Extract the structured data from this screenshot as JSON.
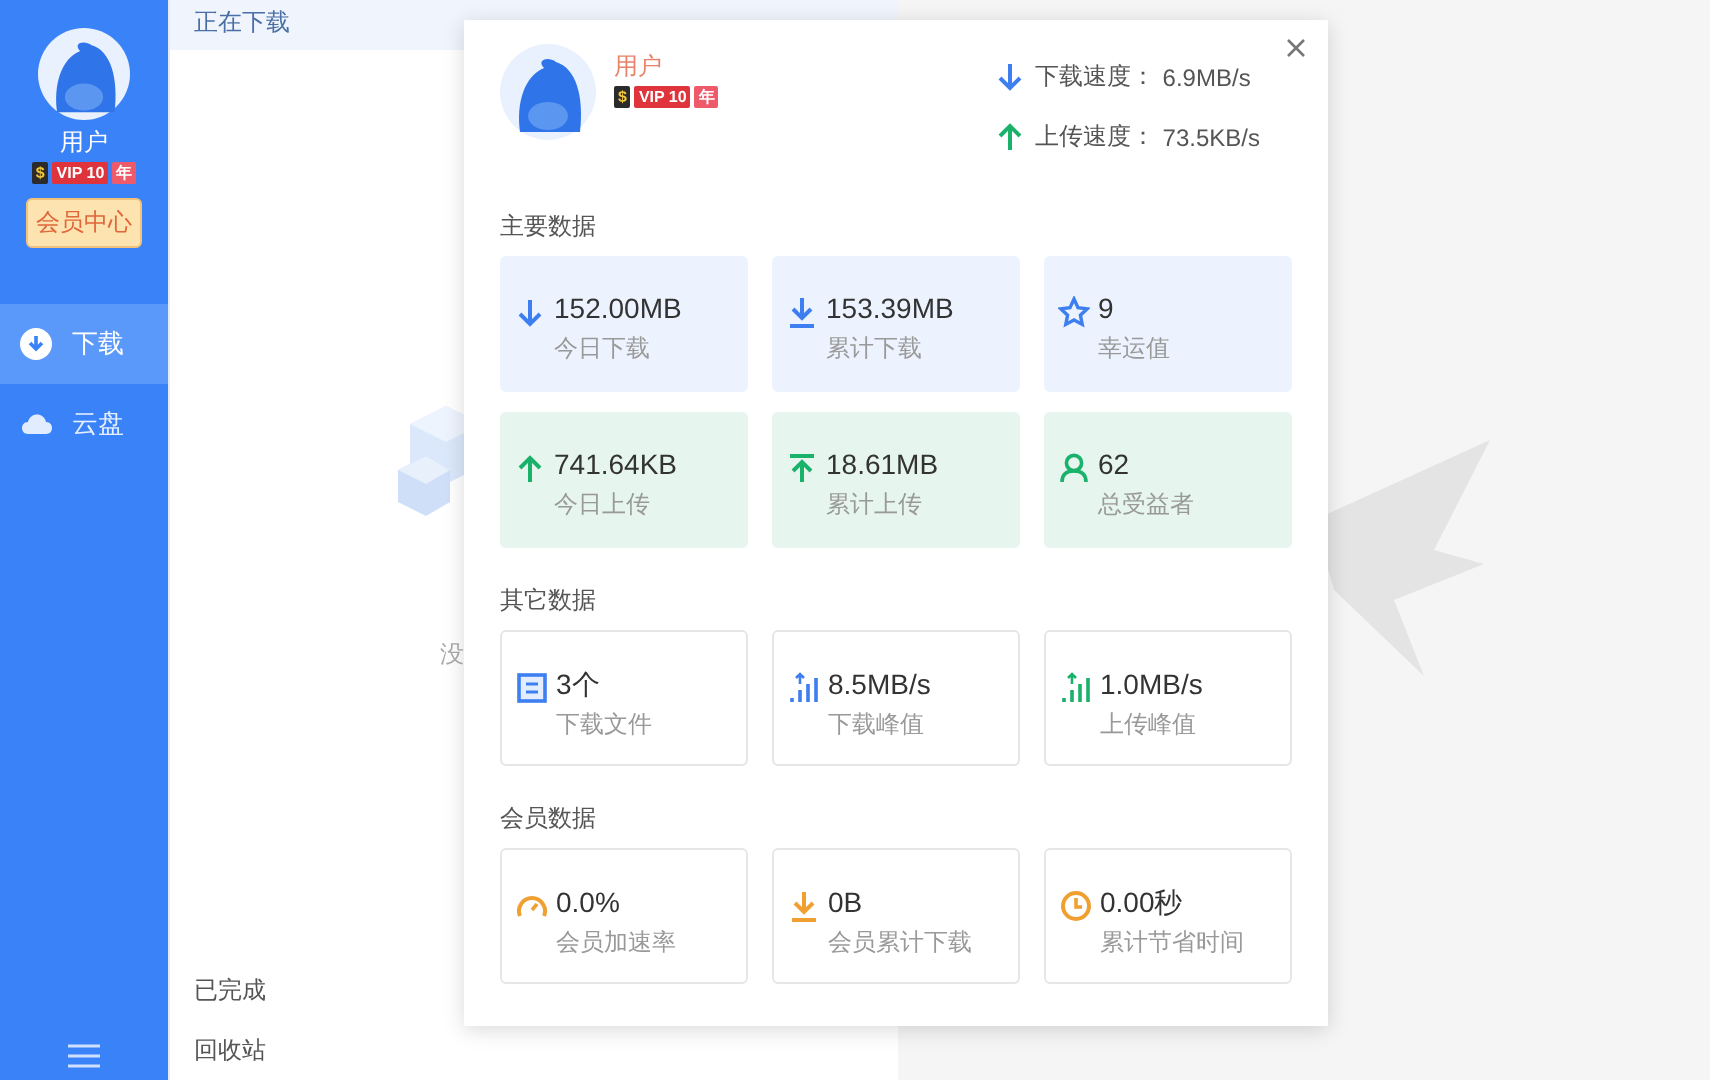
{
  "sidebar": {
    "user": {
      "name": "用户",
      "badges": [
        {
          "kind": "coin",
          "text": "$"
        },
        {
          "kind": "vip",
          "text": "VIP 10"
        },
        {
          "kind": "year",
          "text": "年"
        }
      ]
    },
    "member_button": "会员中心",
    "items": [
      {
        "label": "下载",
        "selected": true
      },
      {
        "label": "云盘",
        "selected": false
      }
    ]
  },
  "list_panel": {
    "tabs": [
      {
        "label": "正在下载",
        "selected": true
      },
      {
        "label": "已完成",
        "selected": false
      },
      {
        "label": "回收站",
        "selected": false
      }
    ],
    "empty_text": "没"
  },
  "popup": {
    "user": {
      "name": "用户",
      "badges": [
        {
          "kind": "coin",
          "text": "$"
        },
        {
          "kind": "vip",
          "text": "VIP 10"
        },
        {
          "kind": "year",
          "text": "年"
        }
      ]
    },
    "speeds": [
      {
        "kind": "download",
        "label": "下载速度：",
        "value": "6.9MB/s"
      },
      {
        "kind": "upload",
        "label": "上传速度：",
        "value": "73.5KB/s"
      }
    ],
    "sections": [
      {
        "title": "主要数据",
        "cards": [
          {
            "kind": "download",
            "value": "152.00MB",
            "label": "今日下载"
          },
          {
            "kind": "download",
            "value": "153.39MB",
            "label": "累计下载"
          },
          {
            "kind": "download",
            "value": "9",
            "label": "幸运值"
          },
          {
            "kind": "upload",
            "value": "741.64KB",
            "label": "今日上传"
          },
          {
            "kind": "upload",
            "value": "18.61MB",
            "label": "累计上传"
          },
          {
            "kind": "upload",
            "value": "62",
            "label": "总受益者"
          }
        ]
      },
      {
        "title": "其它数据",
        "cards": [
          {
            "kind": "plain",
            "value": "3个",
            "label": "下载文件"
          },
          {
            "kind": "plain",
            "value": "8.5MB/s",
            "label": "下载峰值"
          },
          {
            "kind": "plain",
            "value": "1.0MB/s",
            "label": "上传峰值"
          }
        ]
      },
      {
        "title": "会员数据",
        "cards": [
          {
            "kind": "plain",
            "value": "0.0%",
            "label": "会员加速率"
          },
          {
            "kind": "plain",
            "value": "0B",
            "label": "会员累计下载"
          },
          {
            "kind": "plain",
            "value": "0.00秒",
            "label": "累计节省时间"
          }
        ]
      }
    ]
  }
}
